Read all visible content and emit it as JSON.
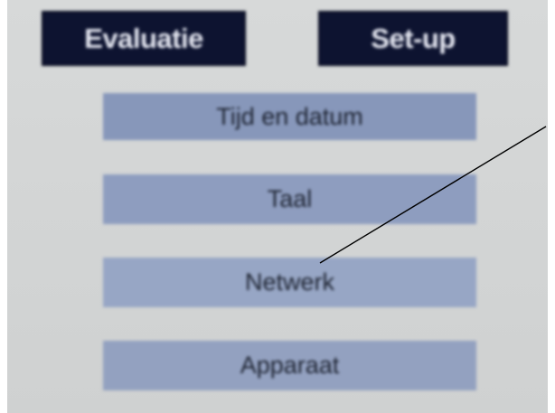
{
  "tabs": {
    "evaluation": "Evaluatie",
    "setup": "Set-up"
  },
  "menu": {
    "items": [
      {
        "label": "Tijd en datum"
      },
      {
        "label": "Taal"
      },
      {
        "label": "Netwerk"
      },
      {
        "label": "Apparaat"
      }
    ]
  },
  "colors": {
    "tab_background": "#0d1330",
    "button_background": "#8d9cbd",
    "screen_background": "#d5d7d7"
  }
}
